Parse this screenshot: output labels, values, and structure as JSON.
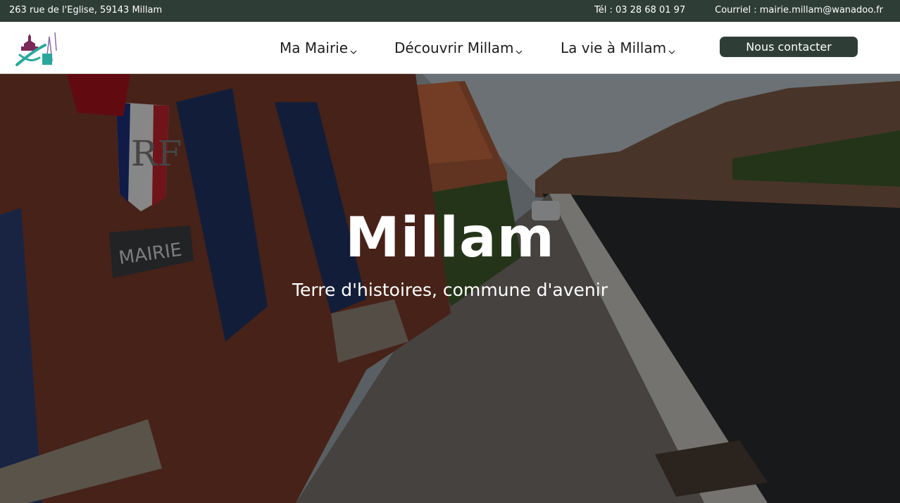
{
  "topbar": {
    "address": "263 rue de l'Eglise, 59143 Millam",
    "phone": "Tél : 03 28 68 01 97",
    "email": "Courriel : mairie.millam@wanadoo.fr"
  },
  "nav": {
    "items": [
      {
        "label": "Ma Mairie"
      },
      {
        "label": "Découvrir Millam"
      },
      {
        "label": "La vie à Millam"
      }
    ],
    "contact_label": "Nous contacter"
  },
  "hero": {
    "title": "Millam",
    "subtitle": "Terre d'histoires, commune d'avenir",
    "sign_text": "MAIRIE",
    "flag_letters": "RF"
  },
  "colors": {
    "dark_green": "#2f3d37",
    "logo_purple": "#7a2a58",
    "logo_teal": "#2aa79b"
  }
}
